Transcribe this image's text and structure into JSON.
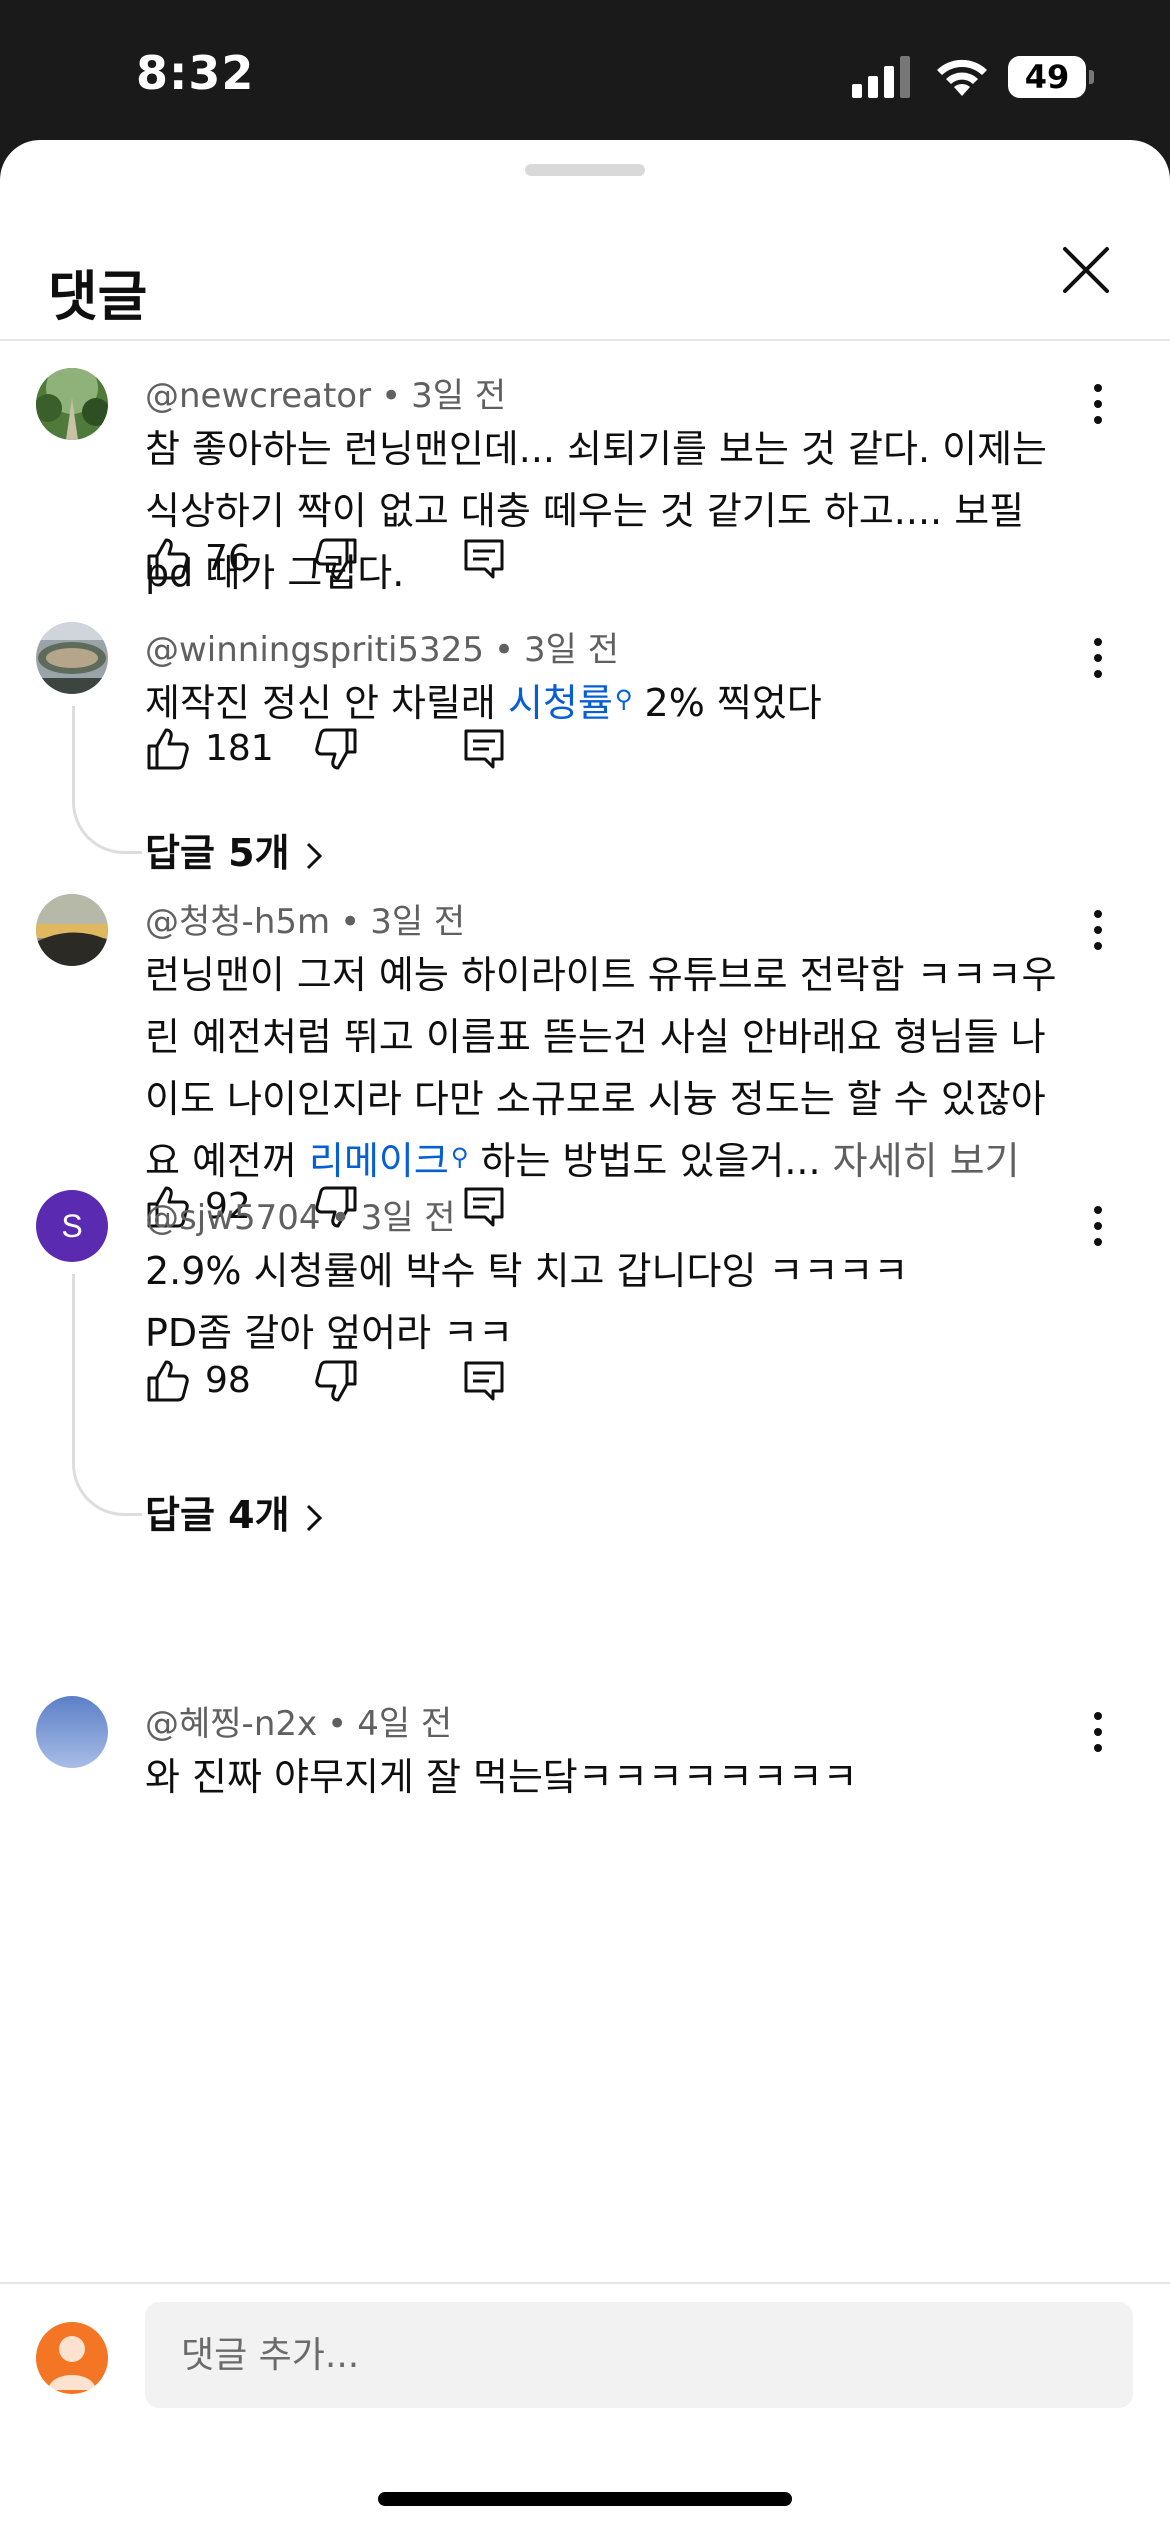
{
  "status_bar": {
    "time": "8:32",
    "battery": "49"
  },
  "sheet": {
    "title": "댓글"
  },
  "comments": [
    {
      "author": "@newcreator",
      "time": "3일 전",
      "lines": [
        "참 좋아하는 런닝맨인데... 쇠퇴기를 보는 것 같다. 이제는",
        "식상하기 짝이 없고 대충 떼우는 것 같기도 하고.... 보필",
        "pd 때가 그립다."
      ],
      "likes": "76"
    },
    {
      "author": "@winningspriti5325",
      "time": "3일 전",
      "text_before": "제작진 정신 안 차릴래 ",
      "link": "시청률",
      "text_after": " 2% 찍었다",
      "likes": "181",
      "replies": "답글 5개"
    },
    {
      "author": "@청청-h5m",
      "time": "3일 전",
      "lines": [
        "런닝맨이 그저 예능 하이라이트 유튜브로 전락함 ㅋㅋㅋ우",
        "린 예전처럼 뛰고 이름표 뜯는건 사실 안바래요 형님들 나",
        "이도 나이인지라 다만 소규모로 시늉 정도는 할 수 있잖아"
      ],
      "last_before": "요 예전꺼 ",
      "link": "리메이크",
      "last_after": " 하는 방법도 있을거...",
      "see_more": "자세히 보기",
      "likes": "92"
    },
    {
      "author": "@sjw5704",
      "time": "3일 전",
      "avatar_letter": "S",
      "lines": [
        "2.9% 시청률에 박수 탁 치고 갑니다잉 ㅋㅋㅋㅋ",
        "PD좀 갈아 엎어라 ㅋㅋ"
      ],
      "likes": "98",
      "replies": "답글 4개"
    },
    {
      "author": "@혜찡-n2x",
      "time": "4일 전",
      "lines": [
        "와 진짜 야무지게 잘 먹는닼ㅋㅋㅋㅋㅋㅋㅋㅋ"
      ]
    }
  ],
  "compose": {
    "placeholder": "댓글 추가..."
  },
  "icons": {
    "like": "thumbs-up-icon",
    "dislike": "thumbs-down-icon",
    "reply": "reply-icon",
    "more": "more-vert-icon",
    "close": "close-icon",
    "chevron": "chevron-right-icon",
    "search_lens": "search-icon"
  },
  "colors": {
    "link": "#065fd4",
    "avatar_sjw": "#5a2bb0",
    "me_avatar": "#f47523"
  }
}
